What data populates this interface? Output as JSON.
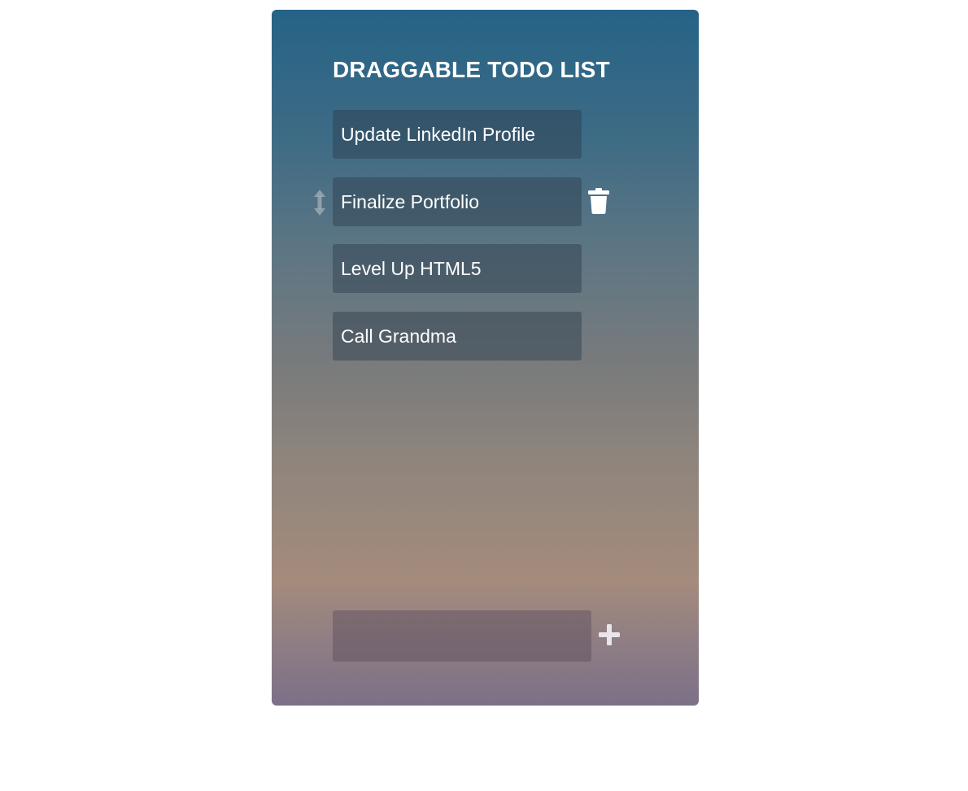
{
  "app": {
    "title": "DRAGGABLE TODO LIST"
  },
  "todos": [
    {
      "label": "Update LinkedIn Profile"
    },
    {
      "label": "Finalize Portfolio"
    },
    {
      "label": "Level Up HTML5"
    },
    {
      "label": "Call Grandma"
    }
  ],
  "active_item": {
    "index": 1,
    "drag_icon": "vertical-resize-arrows-icon",
    "delete_icon": "trash-icon"
  },
  "add_form": {
    "input_value": "",
    "placeholder": "",
    "add_icon": "plus-icon"
  },
  "colors": {
    "gradient_top": "#256386",
    "gradient_mid": "#7a7b7c",
    "gradient_warm": "#a48b7c",
    "gradient_bottom": "#7c7088",
    "text": "#ffffff",
    "page_background": "#ffffff"
  }
}
